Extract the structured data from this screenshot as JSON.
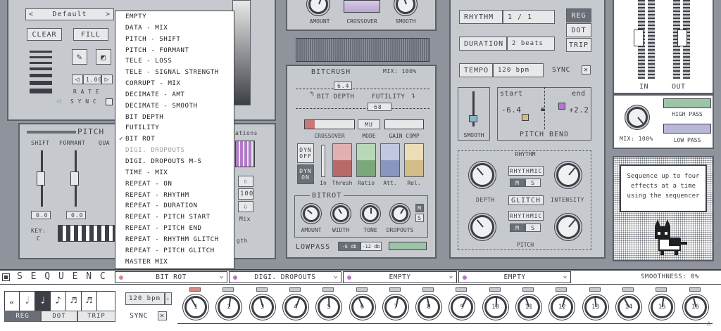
{
  "paint": {
    "preset": "Default",
    "clear": "CLEAR",
    "fill": "FILL",
    "rate_value": "1.00",
    "rate_label": "R A T E",
    "sync_label": "S Y N C"
  },
  "pitch": {
    "title": "PITCH",
    "shift": "SHIFT",
    "formant": "FORMANT",
    "quantize": "QUA",
    "v1": "0.0",
    "v2": "0.0",
    "key_label": "KEY:",
    "key_value": "C",
    "stations": "ations",
    "step": "100",
    "mix": "Mix",
    "length": "gth"
  },
  "top_mid": {
    "amount": "AMOUNT",
    "crossover": "CROSSOVER",
    "smooth": "SMOOTH"
  },
  "bitcrush": {
    "title": "BITCRUSH",
    "mix": "MIX: 100%",
    "bits": "6.4",
    "bit_depth": "BIT DEPTH",
    "futility": "FUTILITY",
    "fut_val": "68",
    "crossover": "CROSSOVER",
    "mode": "MODE",
    "mode_val": "MU",
    "gain": "GAIN COMP"
  },
  "dyn": {
    "off": "DYN OFF",
    "on": "DYN ON",
    "labels": [
      "In",
      "Thresh",
      "Ratio",
      "Att.",
      "Rel."
    ]
  },
  "bitrot": {
    "title": "BITROT",
    "labels": [
      "AMOUNT",
      "WIDTH",
      "TONE",
      "DROPOUTS"
    ],
    "m": "M",
    "s": "S"
  },
  "lowpass": {
    "label": "LOWPASS",
    "a": "-6 db",
    "b": "-12 db"
  },
  "rhythm_panel": {
    "rhythm": "RHYTHM",
    "rhythm_val": "1 /  1",
    "duration": "DURATION",
    "duration_val": "2 beats",
    "tempo": "TEMPO",
    "tempo_val": "120 bpm",
    "sync": "SYNC",
    "reg": "REG",
    "dot": "DOT",
    "trip": "TRIP",
    "smooth": "SMOOTH",
    "start": "start",
    "end": "end",
    "start_val": "-6.4",
    "end_val": "+2.2",
    "pitch_bend": "PITCH BEND"
  },
  "glitch": {
    "rhythm": "RHYTHM",
    "rhythmic1": "RHYTHMIC",
    "rhythmic2": "RHYTHMIC",
    "m": "M",
    "s": "S",
    "depth": "DEPTH",
    "intensity": "INTENSITY",
    "glitch": "GLITCH",
    "pitch": "PITCH"
  },
  "io": {
    "in": "IN",
    "out": "OUT",
    "mix": "MIX: 100%",
    "high": "HIGH PASS",
    "low": "LOW PASS"
  },
  "tip": {
    "text": "Sequence up to four effects at a time using the sequencer"
  },
  "dropdown": {
    "items": [
      {
        "label": "EMPTY"
      },
      {
        "label": "DATA - MIX"
      },
      {
        "label": "PITCH - SHIFT"
      },
      {
        "label": "PITCH - FORMANT"
      },
      {
        "label": "TELE - LOSS"
      },
      {
        "label": "TELE - SIGNAL STRENGTH"
      },
      {
        "label": "CORRUPT - MIX"
      },
      {
        "label": "DECIMATE - AMT"
      },
      {
        "label": "DECIMATE - SMOOTH"
      },
      {
        "label": "BIT DEPTH"
      },
      {
        "label": "FUTILITY"
      },
      {
        "label": "BIT ROT",
        "check": "✓"
      },
      {
        "label": "DIGI. DROPOUTS",
        "disabled": true
      },
      {
        "label": "DIGI. DROPOUTS M-S"
      },
      {
        "label": "TIME - MIX"
      },
      {
        "label": "REPEAT - ON"
      },
      {
        "label": "REPEAT - RHYTHM"
      },
      {
        "label": "REPEAT - DURATION"
      },
      {
        "label": "REPEAT - PITCH START"
      },
      {
        "label": "REPEAT - PITCH END"
      },
      {
        "label": "REPEAT - RHYTHM GLITCH"
      },
      {
        "label": "REPEAT - PITCH GLITCH"
      },
      {
        "label": "MASTER MIX"
      }
    ]
  },
  "sequencer": {
    "title": "S E Q U E N C E R",
    "slots": [
      "BIT ROT",
      "DIGI. DROPOUTS",
      "EMPTY",
      "EMPTY"
    ],
    "slot_colors": [
      "#d98888",
      "#b07ac8",
      "#b07ac8",
      "#b07ac8"
    ],
    "smoothness": "SMOOTHNESS:  0%",
    "tempo": "120 bpm",
    "sync": "SYNC",
    "reg": "REG",
    "dot": "DOT",
    "trip": "TRIP",
    "steps": [
      "1",
      "2",
      "3",
      "4",
      "5",
      "6",
      "7",
      "8",
      "9",
      "10",
      "11",
      "12",
      "13",
      "14",
      "15",
      "16"
    ],
    "active_step": "1"
  },
  "colors": {
    "panel": "#c6c9cd",
    "border": "#5c6068",
    "accent_red": "#d98888",
    "accent_purple": "#b07ac8"
  }
}
